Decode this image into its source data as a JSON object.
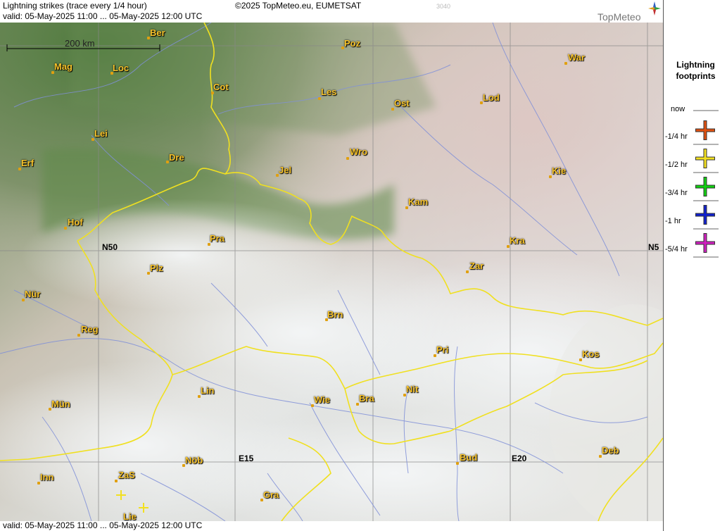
{
  "header": {
    "title": "Lightning strikes (trace every 1/4 hour)",
    "copyright": "©2025 TopMeteo.eu, EUMETSAT",
    "code": "3040",
    "valid": "valid:  05-May-2025 11:00 ... 05-May-2025 12:00 UTC",
    "brand": "TopMeteo"
  },
  "footer": {
    "valid": "valid:  05-May-2025 11:00 ... 05-May-2025 12:00 UTC"
  },
  "scale": {
    "label": "200 km"
  },
  "grid_labels": {
    "n50_left": "N50",
    "n50_right": "N5",
    "e15": "E15",
    "e20": "E20"
  },
  "cities": [
    {
      "name": "Ber"
    },
    {
      "name": "Poz"
    },
    {
      "name": "War"
    },
    {
      "name": "Mag"
    },
    {
      "name": "Loc"
    },
    {
      "name": "Cot"
    },
    {
      "name": "Les"
    },
    {
      "name": "Lod"
    },
    {
      "name": "Ost"
    },
    {
      "name": "Lei"
    },
    {
      "name": "Erf"
    },
    {
      "name": "Dre"
    },
    {
      "name": "Wro"
    },
    {
      "name": "Jel"
    },
    {
      "name": "Kie"
    },
    {
      "name": "Kam"
    },
    {
      "name": "Hof"
    },
    {
      "name": "Pra"
    },
    {
      "name": "Kra"
    },
    {
      "name": "Plz"
    },
    {
      "name": "Zar"
    },
    {
      "name": "Nür"
    },
    {
      "name": "Brn"
    },
    {
      "name": "Reg"
    },
    {
      "name": "Pri"
    },
    {
      "name": "Kos"
    },
    {
      "name": "Lin"
    },
    {
      "name": "Nit"
    },
    {
      "name": "Mün"
    },
    {
      "name": "Wie"
    },
    {
      "name": "Bra"
    },
    {
      "name": "Deb"
    },
    {
      "name": "Bud"
    },
    {
      "name": "Nöb"
    },
    {
      "name": "ZaS"
    },
    {
      "name": "Inn"
    },
    {
      "name": "Gra"
    },
    {
      "name": "Lie"
    }
  ],
  "legend": {
    "title_line1": "Lightning",
    "title_line2": "footprints",
    "items": [
      {
        "label": "now",
        "color": ""
      },
      {
        "label": "-1/4 hr",
        "color": "#e05010"
      },
      {
        "label": "-1/2 hr",
        "color": "#f2e020"
      },
      {
        "label": "-3/4 hr",
        "color": "#10d010"
      },
      {
        "label": "-1 hr",
        "color": "#1020d0"
      },
      {
        "label": "-5/4 hr",
        "color": "#d020c0"
      }
    ]
  },
  "strikes": [
    {
      "age": "-1/2 hr",
      "color": "#f2e020"
    },
    {
      "age": "-1/2 hr",
      "color": "#f2e020"
    }
  ],
  "colors": {
    "border": "#f0e020",
    "river": "#8090d8",
    "grid": "#888888",
    "city": "#f6c22a"
  }
}
